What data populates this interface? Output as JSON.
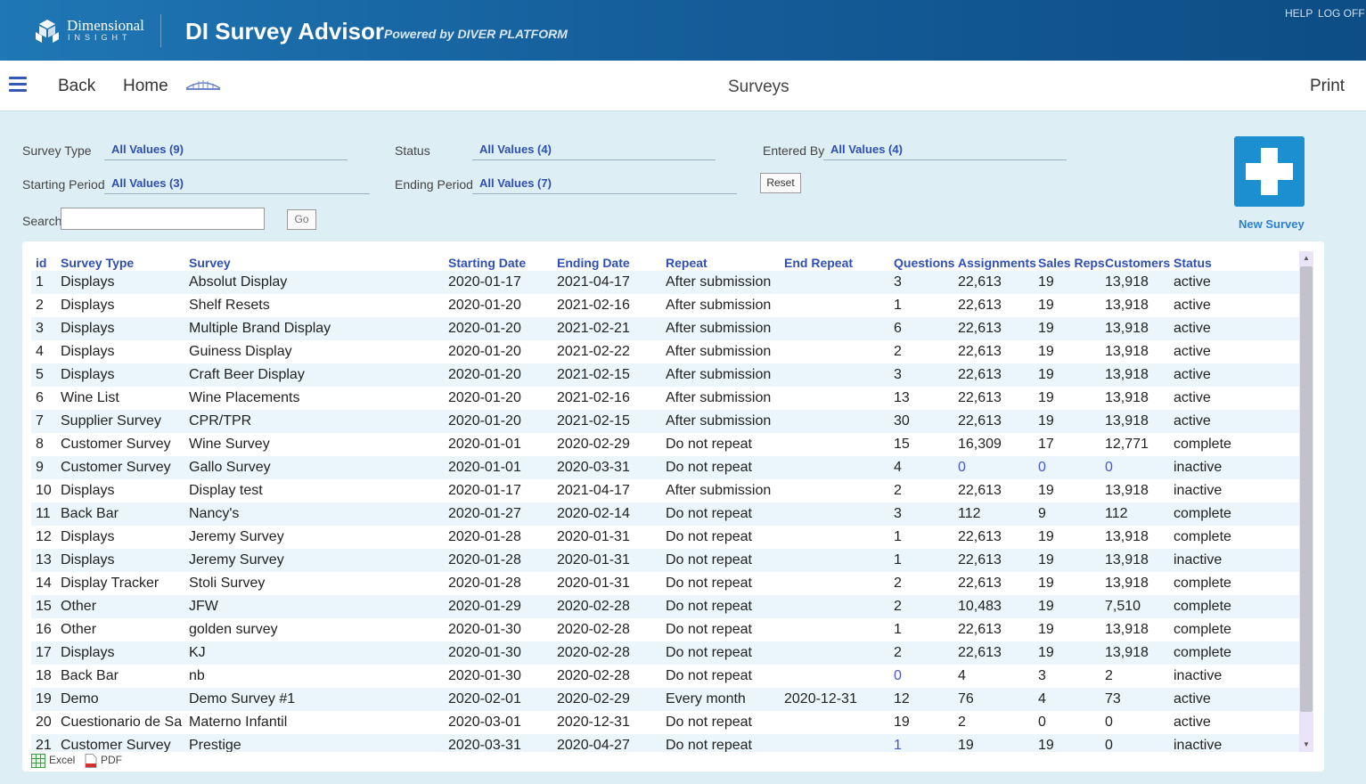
{
  "header": {
    "logo_brand": "Dimensional",
    "logo_sub": "INSIGHT",
    "app_title": "DI Survey Advisor",
    "powered_by": "Powered by DIVER PLATFORM",
    "help": "HELP",
    "logoff": "LOG OFF"
  },
  "nav": {
    "menu_icon": "hamburger-menu-icon",
    "back": "Back",
    "home": "Home",
    "bridge_icon": "bridge-icon",
    "title": "Surveys",
    "print": "Print"
  },
  "filters": {
    "survey_type": {
      "label": "Survey Type",
      "value": "All Values (9)"
    },
    "status": {
      "label": "Status",
      "value": "All Values (4)"
    },
    "entered_by": {
      "label": "Entered By",
      "value": "All Values (4)"
    },
    "starting_period": {
      "label": "Starting Period",
      "value": "All Values (3)"
    },
    "ending_period": {
      "label": "Ending Period",
      "value": "All Values (7)"
    },
    "reset": "Reset",
    "search_label": "Search",
    "search_value": "",
    "go": "Go"
  },
  "new_survey": {
    "label": "New Survey",
    "icon": "plus-icon",
    "color": "#1b8fd0"
  },
  "table": {
    "columns": [
      "id",
      "Survey Type",
      "Survey",
      "Starting Date",
      "Ending Date",
      "Repeat",
      "End Repeat",
      "Questions",
      "Assignments",
      "Sales Reps",
      "Customers",
      "Status"
    ],
    "rows": [
      [
        "1",
        "Displays",
        "Absolut Display",
        "2020-01-17",
        "2021-04-17",
        "After submission",
        "",
        "3",
        "22,613",
        "19",
        "13,918",
        "active"
      ],
      [
        "2",
        "Displays",
        "Shelf Resets",
        "2020-01-20",
        "2021-02-16",
        "After submission",
        "",
        "1",
        "22,613",
        "19",
        "13,918",
        "active"
      ],
      [
        "3",
        "Displays",
        "Multiple Brand Display",
        "2020-01-20",
        "2021-02-21",
        "After submission",
        "",
        "6",
        "22,613",
        "19",
        "13,918",
        "active"
      ],
      [
        "4",
        "Displays",
        "Guiness Display",
        "2020-01-20",
        "2021-02-22",
        "After submission",
        "",
        "2",
        "22,613",
        "19",
        "13,918",
        "active"
      ],
      [
        "5",
        "Displays",
        "Craft Beer Display",
        "2020-01-20",
        "2021-02-15",
        "After submission",
        "",
        "3",
        "22,613",
        "19",
        "13,918",
        "active"
      ],
      [
        "6",
        "Wine List",
        "Wine Placements",
        "2020-01-20",
        "2021-02-16",
        "After submission",
        "",
        "13",
        "22,613",
        "19",
        "13,918",
        "active"
      ],
      [
        "7",
        "Supplier Survey",
        "CPR/TPR",
        "2020-01-20",
        "2021-02-15",
        "After submission",
        "",
        "30",
        "22,613",
        "19",
        "13,918",
        "active"
      ],
      [
        "8",
        "Customer Survey",
        "Wine Survey",
        "2020-01-01",
        "2020-02-29",
        "Do not repeat",
        "",
        "15",
        "16,309",
        "17",
        "12,771",
        "complete"
      ],
      [
        "9",
        "Customer Survey",
        "Gallo Survey",
        "2020-01-01",
        "2020-03-31",
        "Do not repeat",
        "",
        "4",
        "0",
        "0",
        "0",
        "inactive"
      ],
      [
        "10",
        "Displays",
        "Display test",
        "2020-01-17",
        "2021-04-17",
        "After submission",
        "",
        "2",
        "22,613",
        "19",
        "13,918",
        "inactive"
      ],
      [
        "11",
        "Back Bar",
        "Nancy's",
        "2020-01-27",
        "2020-02-14",
        "Do not repeat",
        "",
        "3",
        "112",
        "9",
        "112",
        "complete"
      ],
      [
        "12",
        "Displays",
        "Jeremy Survey",
        "2020-01-28",
        "2020-01-31",
        "Do not repeat",
        "",
        "1",
        "22,613",
        "19",
        "13,918",
        "complete"
      ],
      [
        "13",
        "Displays",
        "Jeremy Survey",
        "2020-01-28",
        "2020-01-31",
        "Do not repeat",
        "",
        "1",
        "22,613",
        "19",
        "13,918",
        "inactive"
      ],
      [
        "14",
        "Display Tracker",
        "Stoli Survey",
        "2020-01-28",
        "2020-01-31",
        "Do not repeat",
        "",
        "2",
        "22,613",
        "19",
        "13,918",
        "complete"
      ],
      [
        "15",
        "Other",
        "JFW",
        "2020-01-29",
        "2020-02-28",
        "Do not repeat",
        "",
        "2",
        "10,483",
        "19",
        "7,510",
        "complete"
      ],
      [
        "16",
        "Other",
        "golden survey",
        "2020-01-30",
        "2020-02-28",
        "Do not repeat",
        "",
        "1",
        "22,613",
        "19",
        "13,918",
        "complete"
      ],
      [
        "17",
        "Displays",
        "KJ",
        "2020-01-30",
        "2020-02-28",
        "Do not repeat",
        "",
        "2",
        "22,613",
        "19",
        "13,918",
        "complete"
      ],
      [
        "18",
        "Back Bar",
        "nb",
        "2020-01-30",
        "2020-02-28",
        "Do not repeat",
        "",
        "0",
        "4",
        "3",
        "2",
        "inactive"
      ],
      [
        "19",
        "Demo",
        "Demo Survey #1",
        "2020-02-01",
        "2020-02-29",
        "Every month",
        "2020-12-31",
        "12",
        "76",
        "4",
        "73",
        "active"
      ],
      [
        "20",
        "Cuestionario de Sa",
        "Materno Infantil",
        "2020-03-01",
        "2020-12-31",
        "Do not repeat",
        "",
        "19",
        "2",
        "0",
        "0",
        "active"
      ],
      [
        "21",
        "Customer Survey",
        "Prestige",
        "2020-03-31",
        "2020-04-27",
        "Do not repeat",
        "",
        "1",
        "19",
        "19",
        "0",
        "inactive"
      ]
    ],
    "link_cells": [
      [
        8,
        8
      ],
      [
        8,
        9
      ],
      [
        8,
        10
      ],
      [
        17,
        7
      ],
      [
        20,
        7
      ]
    ]
  },
  "export": {
    "excel": "Excel",
    "pdf": "PDF"
  }
}
